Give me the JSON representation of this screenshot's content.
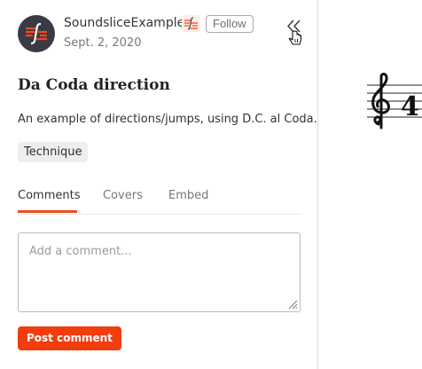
{
  "header": {
    "username": "SoundsliceExamples",
    "follow_label": "Follow",
    "date": "Sept. 2, 2020"
  },
  "icons": {
    "avatar": "soundslice-logo",
    "badge": "soundslice-logo-small",
    "collapse": "double-chevron-left-icon",
    "cursor": "hand-pointer-icon",
    "resize": "resize-handle-icon"
  },
  "colors": {
    "accent": "#ee4c1f",
    "post_button": "#f23d0e",
    "avatar_bg": "#3a3a44"
  },
  "main": {
    "title": "Da Coda direction",
    "description": "An example of directions/jumps, using D.C. al Coda.",
    "tag": "Technique"
  },
  "tabs": [
    {
      "label": "Comments",
      "active": true
    },
    {
      "label": "Covers",
      "active": false
    },
    {
      "label": "Embed",
      "active": false
    }
  ],
  "comment": {
    "placeholder": "Add a comment...",
    "value": "",
    "post_label": "Post comment"
  },
  "notation": {
    "clef": "treble",
    "time_signature": "4"
  }
}
